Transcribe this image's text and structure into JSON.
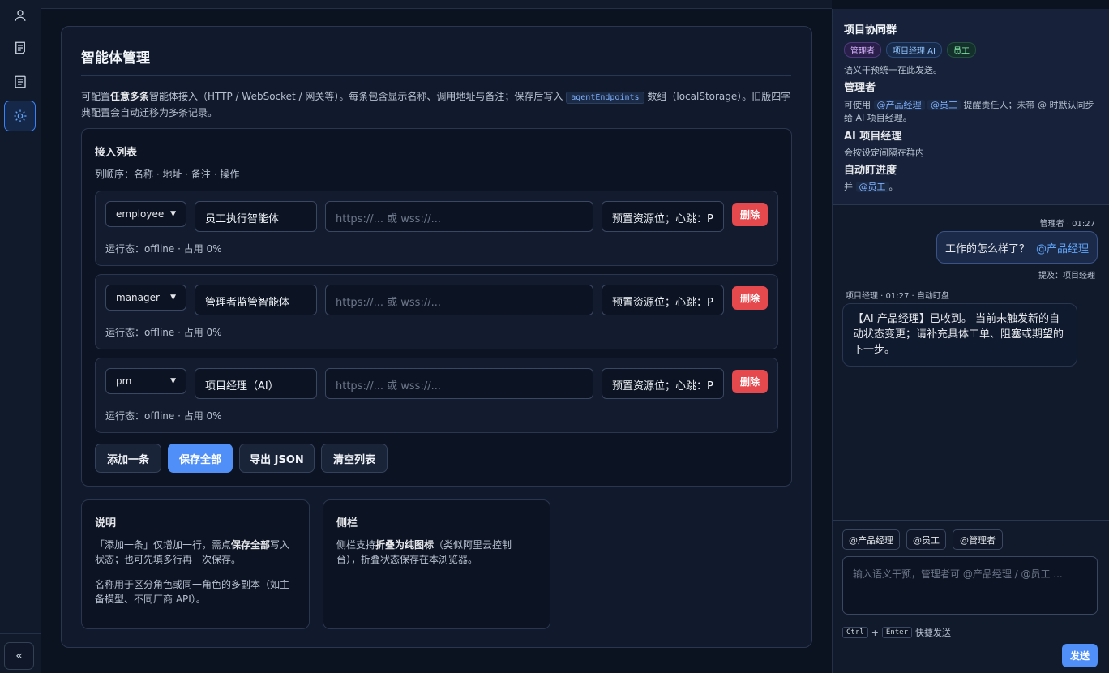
{
  "rail": {
    "items": [
      {
        "icon": "user-icon"
      },
      {
        "icon": "document-icon"
      },
      {
        "icon": "list-document-icon"
      },
      {
        "icon": "settings-sun-icon"
      }
    ],
    "collapse_label": "«"
  },
  "main": {
    "title": "智能体管理",
    "intro_a": "可配置",
    "intro_bold": "任意多条",
    "intro_b": "智能体接入（HTTP / WebSocket / 网关等）。每条包含显示名称、调用地址与备注；保存后写入",
    "intro_code": "agentEndpoints",
    "intro_c": "数组（localStorage）。旧版四字典配置会自动迁移为多条记录。",
    "list": {
      "title": "接入列表",
      "subtitle": "列顺序：名称 · 地址 · 备注 · 操作",
      "rows": [
        {
          "role": "employee",
          "name": "员工执行智能体",
          "url_placeholder": "https://... 或 wss://...",
          "note": "预置资源位；心跳：P",
          "delete_label": "删除",
          "status": "运行态：offline · 占用 0%"
        },
        {
          "role": "manager",
          "name": "管理者监管智能体",
          "url_placeholder": "https://... 或 wss://...",
          "note": "预置资源位；心跳：P",
          "delete_label": "删除",
          "status": "运行态：offline · 占用 0%"
        },
        {
          "role": "pm",
          "name": "项目经理（AI）",
          "url_placeholder": "https://... 或 wss://...",
          "note": "预置资源位；心跳：P",
          "delete_label": "删除",
          "status": "运行态：offline · 占用 0%"
        }
      ],
      "buttons": {
        "add": "添加一条",
        "save": "保存全部",
        "export": "导出 JSON",
        "clear": "清空列表"
      }
    },
    "notes": {
      "title": "说明",
      "p1_a": "「添加一条」仅增加一行，需点",
      "p1_bold": "保存全部",
      "p1_b": "写入状态；也可先填多行再一次保存。",
      "p2": "名称用于区分角色或同一角色的多副本（如主备模型、不同厂商 API）。"
    },
    "sidebar_note": {
      "title": "侧栏",
      "p_a": "侧栏支持",
      "p_bold": "折叠为纯图标",
      "p_b": "（类似阿里云控制台），折叠状态保存在本浏览器。"
    }
  },
  "chat": {
    "group_title": "项目协同群",
    "tags": [
      "管理者",
      "项目经理 AI",
      "员工"
    ],
    "line1": "语义干预统一在此发送。",
    "h_admin": "管理者",
    "admin_a": "可使用",
    "admin_m1": "@产品经理",
    "admin_m2": "@员工",
    "admin_b": "提醒责任人；未带 @ 时默认同步给 AI 项目经理。",
    "h_pm": "AI 项目经理",
    "pm_line": "会按设定间隔在群内",
    "h_auto": "自动盯进度",
    "auto_a": "并",
    "auto_m": "@员工",
    "auto_b": "。",
    "msg1_meta": "管理者 · 01:27",
    "msg1_text": "工作的怎么样了？",
    "msg1_at": "@产品经理",
    "msg1_ref": "提及：项目经理",
    "msg2_meta": "项目经理 · 01:27 · 自动盯盘",
    "msg2_text": "【AI 产品经理】已收到。 当前未触发新的自动状态变更；请补充具体工单、阻塞或期望的下一步。",
    "chips": [
      "@产品经理",
      "@员工",
      "@管理者"
    ],
    "input_placeholder": "输入语义干预，管理者可 @产品经理 / @员工 ...",
    "kbd1": "Ctrl",
    "plus": "+",
    "kbd2": "Enter",
    "hint": "快捷发送",
    "send_label": "发送"
  },
  "colors": {
    "accent": "#4f8ff7",
    "danger": "#e5484d",
    "background": "#0b1220"
  }
}
